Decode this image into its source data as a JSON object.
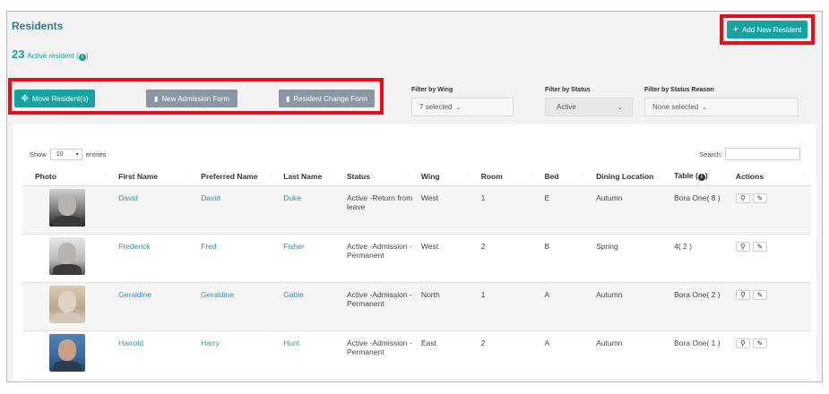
{
  "header": {
    "title": "Residents",
    "active_count": "23",
    "active_label": "Active resident (",
    "active_label_end": ")",
    "info_icon": "info-icon",
    "add_button": "Add New Resident"
  },
  "toolbar": {
    "move_button": "Move Resident(s)",
    "admission_button": "New Admission Form",
    "change_button": "Resident Change Form"
  },
  "filters": {
    "wing_label": "Filter by Wing",
    "wing_value": "7 selected",
    "status_label": "Filter by Status",
    "status_value": "Active",
    "reason_label": "Filter by Status Reason",
    "reason_value": "None selected"
  },
  "table_controls": {
    "show_label": "Show",
    "page_size": "10",
    "entries_label": "entries",
    "search_label": "Search:"
  },
  "columns": {
    "photo": "Photo",
    "first_name": "First Name",
    "preferred_name": "Preferred Name",
    "last_name": "Last Name",
    "status": "Status",
    "wing": "Wing",
    "room": "Room",
    "bed": "Bed",
    "dining": "Dining Location",
    "table": "Table (",
    "table_end": ")",
    "actions": "Actions"
  },
  "rows": [
    {
      "first": "David",
      "preferred": "David",
      "last": "Duke",
      "status": "Active -Return from leave",
      "wing": "West",
      "room": "1",
      "bed": "E",
      "dining": "Autumn",
      "table": "Bora One( 8 )"
    },
    {
      "first": "Frederick",
      "preferred": "Fred",
      "last": "Fisher",
      "status": "Active -Admission - Permanent",
      "wing": "West",
      "room": "2",
      "bed": "B",
      "dining": "Spring",
      "table": "4( 2 )"
    },
    {
      "first": "Geraldine",
      "preferred": "Geraldine",
      "last": "Gable",
      "status": "Active -Admission - Permanent",
      "wing": "North",
      "room": "1",
      "bed": "A",
      "dining": "Autumn",
      "table": "Bora One( 2 )"
    },
    {
      "first": "Harrold",
      "preferred": "Harry",
      "last": "Hunt",
      "status": "Active -Admission - Permanent",
      "wing": "East",
      "room": "2",
      "bed": "A",
      "dining": "Autumn",
      "table": "Bora One( 1 )"
    }
  ],
  "colors": {
    "accent": "#17a2a2",
    "highlight": "#e3101b",
    "link": "#2b8fb0",
    "secondary_button": "#8a96a3"
  }
}
